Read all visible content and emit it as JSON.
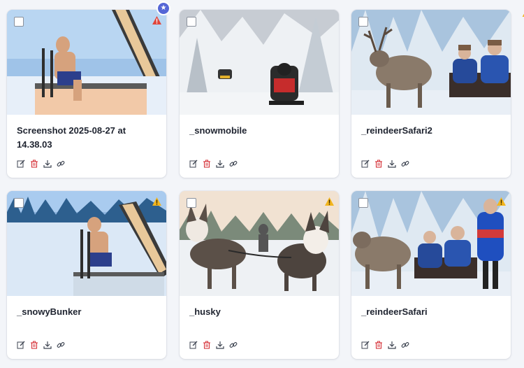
{
  "colors": {
    "warn_red": "#e0443a",
    "warn_yellow": "#f2b51d",
    "accent": "#5566d6",
    "delete_red": "#d6333a",
    "icon_gray": "#3c4350"
  },
  "cards": [
    {
      "title": "Screenshot 2025-08-27 at 14.38.03",
      "warning": "red",
      "starred": true,
      "image": "ice-bath"
    },
    {
      "title": "_snowmobile",
      "warning": "none",
      "starred": false,
      "image": "snowmobile"
    },
    {
      "title": "_reindeerSafari2",
      "warning": "none",
      "starred": false,
      "image": "reindeer-sleigh"
    },
    {
      "title": "_snowyBunker",
      "warning": "yellow",
      "starred": false,
      "image": "ice-bath"
    },
    {
      "title": "_husky",
      "warning": "yellow",
      "starred": false,
      "image": "husky-sled"
    },
    {
      "title": "_reindeerSafari",
      "warning": "yellow",
      "starred": false,
      "image": "reindeer-sleigh"
    }
  ],
  "actions": [
    "edit-icon",
    "trash-icon",
    "download-icon",
    "link-icon"
  ]
}
